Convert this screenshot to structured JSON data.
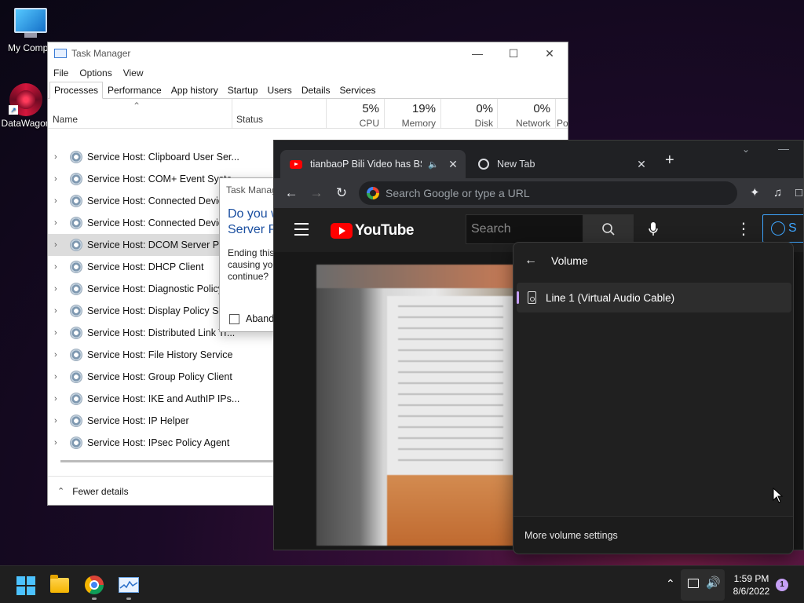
{
  "desktop": {
    "icons": [
      {
        "label": "My Compu",
        "icon": "computer-icon"
      },
      {
        "label": "DataWagon",
        "icon": "datawagon-icon"
      }
    ]
  },
  "task_manager": {
    "title": "Task Manager",
    "menu": [
      "File",
      "Options",
      "View"
    ],
    "tabs": [
      "Processes",
      "Performance",
      "App history",
      "Startup",
      "Users",
      "Details",
      "Services"
    ],
    "active_tab": "Processes",
    "columns": {
      "name": "Name",
      "status": "Status",
      "cpu": {
        "pct": "5%",
        "label": "CPU"
      },
      "memory": {
        "pct": "19%",
        "label": "Memory"
      },
      "disk": {
        "pct": "0%",
        "label": "Disk"
      },
      "network": {
        "pct": "0%",
        "label": "Network"
      },
      "power": "Po"
    },
    "rows": [
      "Service Host: Clipboard User Ser...",
      "Service Host: COM+ Event Syste",
      "Service Host: Connected Device",
      "Service Host: Connected Device",
      "Service Host: DCOM Server Proc",
      "Service Host: DHCP Client",
      "Service Host: Diagnostic Policy ...",
      "Service Host: Display Policy Serv",
      "Service Host: Distributed Link Tr...",
      "Service Host: File History Service",
      "Service Host: Group Policy Client",
      "Service Host: IKE and AuthIP IPs...",
      "Service Host: IP Helper",
      "Service Host: IPsec Policy Agent"
    ],
    "selected_row": 4,
    "footer": "Fewer details",
    "dialog": {
      "title": "Task Manag",
      "heading_1": "Do you w",
      "heading_2": "Server P",
      "body_1": "Ending this",
      "body_2": "causing yo",
      "body_3": "continue?",
      "checkbox": "Aband"
    }
  },
  "chrome": {
    "tabs": [
      {
        "title": "tianbaoP Bili Video has BSOD",
        "active": true
      },
      {
        "title": "New Tab",
        "active": false
      }
    ],
    "omnibox_placeholder": "Search Google or type a URL",
    "youtube": {
      "logo_text": "YouTube",
      "search_placeholder": "Search",
      "signin_text": "S"
    }
  },
  "volume_flyout": {
    "title": "Volume",
    "device": "Line 1 (Virtual Audio Cable)",
    "footer": "More volume settings",
    "accent_color": "#c6a0f6"
  },
  "taskbar": {
    "time": "1:59 PM",
    "date": "8/6/2022",
    "notification_count": "1"
  }
}
